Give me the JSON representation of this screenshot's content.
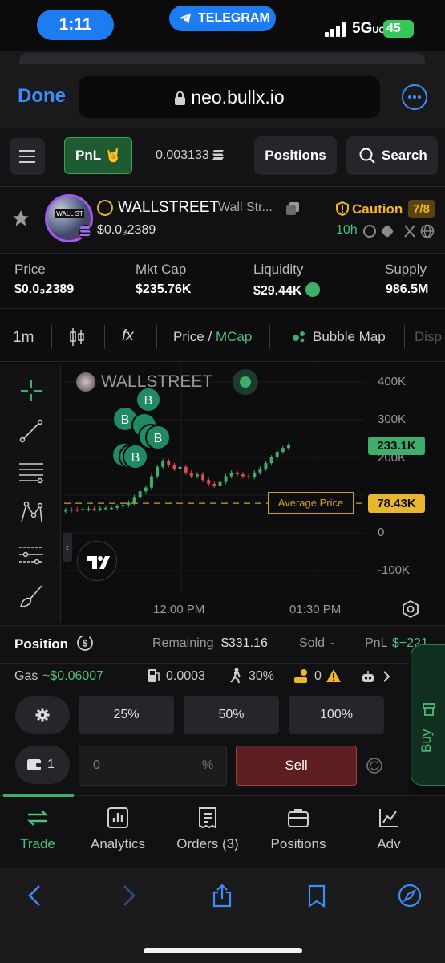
{
  "status_bar": {
    "time": "1:11",
    "notification_app": "TELEGRAM",
    "network": "5G",
    "network_suffix": "UC",
    "battery": "45"
  },
  "browser": {
    "done_label": "Done",
    "url": "neo.bullx.io"
  },
  "top_bar": {
    "pnl_label": "PnL",
    "pnl_emoji": "🤘",
    "balance": "0.003133",
    "positions_label": "Positions",
    "search_label": "Search"
  },
  "token": {
    "symbol": "WALLSTREET",
    "name": "Wall Str...",
    "price": "$0.0₃2389",
    "caution_label": "Caution",
    "caution_score": "7/8",
    "age": "10h"
  },
  "stats": [
    {
      "label": "Price",
      "value": "$0.0₃2389"
    },
    {
      "label": "Mkt Cap",
      "value": "$235.76K"
    },
    {
      "label": "Liquidity",
      "value": "$29.44K"
    },
    {
      "label": "Supply",
      "value": "986.5M"
    }
  ],
  "chart_toolbar": {
    "interval": "1m",
    "fx": "fx",
    "price_label": "Price",
    "separator": "/",
    "mcap_label": "MCap",
    "bubble_map_label": "Bubble Map",
    "disp_label": "Disp"
  },
  "chart": {
    "title": "WALLSTREET",
    "y_ticks": [
      "400K",
      "300K",
      "200K",
      "100K",
      "0",
      "-100K"
    ],
    "current_price_tag": "233.1K",
    "avg_price_tag": "78.43K",
    "avg_price_label": "Average Price",
    "x_ticks": [
      "12:00 PM",
      "01:30 PM"
    ],
    "bubble_letter": "B",
    "colors": {
      "up": "#3fae6a",
      "down": "#e04b4b",
      "avg": "#c9a227"
    }
  },
  "chart_data": {
    "type": "candlestick",
    "title": "WALLSTREET",
    "ylabel": "MCap",
    "ylim": [
      -150000,
      420000
    ],
    "y_ticks": [
      400000,
      300000,
      200000,
      100000,
      0,
      -100000
    ],
    "x_ticks": [
      "12:00 PM",
      "01:30 PM"
    ],
    "series": [
      {
        "name": "MCap",
        "close": [
          60000,
          62000,
          61000,
          63000,
          64000,
          63000,
          65000,
          66000,
          66500,
          70000,
          74000,
          80000,
          95000,
          110000,
          120000,
          150000,
          175000,
          190000,
          180000,
          170000,
          175000,
          160000,
          150000,
          155000,
          140000,
          130000,
          125000,
          135000,
          150000,
          160000,
          155000,
          150000,
          148000,
          160000,
          170000,
          185000,
          200000,
          215000,
          225000,
          233100
        ]
      }
    ],
    "annotations": [
      {
        "label": "Average Price",
        "y": 78430
      },
      {
        "label": "233.1K",
        "y": 233100
      }
    ],
    "buy_markers": 8
  },
  "position": {
    "title": "Position",
    "remaining_label": "Remaining",
    "remaining_value": "$331.16",
    "sold_label": "Sold",
    "sold_value": "-",
    "pnl_label": "PnL",
    "pnl_value": "$+221"
  },
  "gas": {
    "gas_label": "Gas",
    "gas_value": "~$0.06007",
    "priority_fee": "0.0003",
    "slippage": "30%",
    "bribe_count": "0"
  },
  "trade": {
    "presets": [
      "25%",
      "50%",
      "100%"
    ],
    "wallet_count": "1",
    "amount_placeholder": "0",
    "amount_unit": "%",
    "sell_label": "Sell",
    "buy_label": "Buy"
  },
  "tabs": [
    {
      "label": "Trade"
    },
    {
      "label": "Analytics"
    },
    {
      "label": "Orders (3)"
    },
    {
      "label": "Positions"
    },
    {
      "label": "Adv"
    }
  ]
}
